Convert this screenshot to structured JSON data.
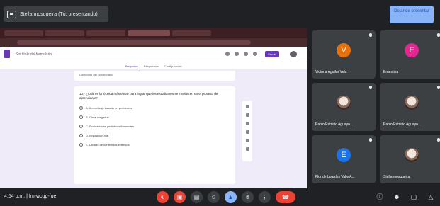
{
  "presentation": {
    "label": "Stella mosqueira (Tú, presentando)",
    "stop_label": "Dejar de presentar"
  },
  "form": {
    "title": "Sin título del formulario",
    "send_label": "Enviar",
    "tabs": [
      "Preguntas",
      "Respuestas",
      "Configuración"
    ],
    "top_option": "Contenido del cuestionario",
    "question": "10.- ¿Cuál es la técnica más eficaz para lograr que los estudiantes se involucren en el proceso de aprendizaje?",
    "options": [
      "A. Aprendizaje basado en problemas",
      "B. Clase magistral",
      "C. Evaluaciones periódicas frecuentes",
      "D. Exposición oral",
      "E. Dictado de contenidos extensos"
    ]
  },
  "participants": [
    {
      "name": "Victoria Aguilar Vela",
      "initial": "V",
      "color": "#e8710a"
    },
    {
      "name": "Ernestina",
      "initial": "E",
      "color": "#e52592"
    },
    {
      "name": "Pablo Patricio Aguayo...",
      "initial": "",
      "color": "#3c4043"
    },
    {
      "name": "Pablo Patricio Aguayo...",
      "initial": "",
      "color": "#3c4043"
    },
    {
      "name": "Flor de Lourdes Valle A...",
      "initial": "E",
      "color": "#1a73e8"
    },
    {
      "name": "Stella mosqueira",
      "initial": "",
      "color": "#3c4043"
    }
  ],
  "bottom": {
    "time": "4:54 p.m. | fm-wcqp-fue"
  },
  "icons": {
    "controls": [
      "mic-off-icon",
      "camera-off-icon",
      "captions-icon",
      "emoji-icon",
      "present-icon",
      "raise-hand-icon",
      "more-icon",
      "end-call-icon"
    ],
    "right": [
      "info-icon",
      "people-icon",
      "chat-icon",
      "activities-icon"
    ]
  },
  "colors": {
    "accent": "#673ab7",
    "danger": "#ea4335",
    "meet_blue": "#8ab4f8"
  }
}
